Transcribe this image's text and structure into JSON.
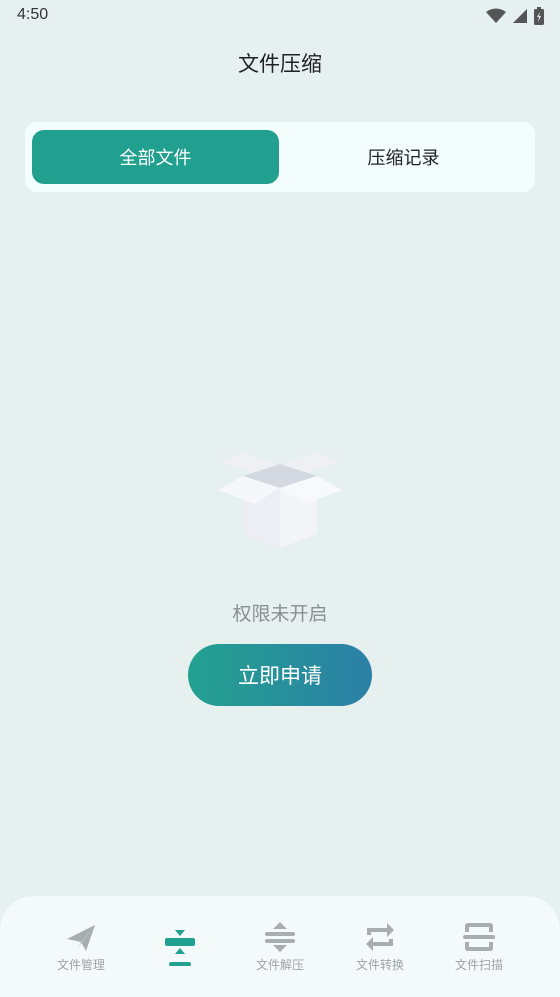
{
  "status_bar": {
    "time": "4:50"
  },
  "header": {
    "title": "文件压缩"
  },
  "tabs": [
    {
      "label": "全部文件",
      "active": true
    },
    {
      "label": "压缩记录",
      "active": false
    }
  ],
  "empty_state": {
    "icon": "empty-box-icon",
    "message": "权限未开启",
    "button_label": "立即申请"
  },
  "bottom_nav": {
    "items": [
      {
        "label": "文件管理",
        "icon": "paper-plane-icon",
        "active": false
      },
      {
        "label": "",
        "icon": "compress-icon",
        "active": true
      },
      {
        "label": "文件解压",
        "icon": "decompress-icon",
        "active": false
      },
      {
        "label": "文件转换",
        "icon": "convert-icon",
        "active": false
      },
      {
        "label": "文件扫描",
        "icon": "scan-icon",
        "active": false
      }
    ]
  },
  "colors": {
    "accent": "#21a08f",
    "gradient_end": "#2b80a6",
    "background": "#e5f0ef",
    "inactive_icon": "#a8adad"
  }
}
